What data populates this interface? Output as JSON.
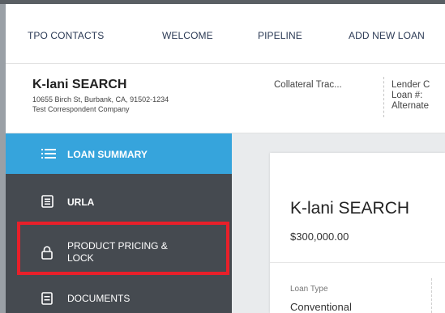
{
  "nav": {
    "items": [
      "TPO CONTACTS",
      "WELCOME",
      "PIPELINE",
      "ADD NEW LOAN"
    ]
  },
  "borrower": {
    "name": "K-lani SEARCH",
    "address": "10655 Birch St, Burbank, CA, 91502-1234",
    "company": "Test Correspondent Company",
    "collateral": "Collateral Trac...",
    "lender_lines": [
      "Lender C",
      "Loan #:",
      "Alternate"
    ]
  },
  "sidebar": {
    "items": [
      {
        "label": "LOAN SUMMARY",
        "icon": "list-icon"
      },
      {
        "label": "URLA",
        "icon": "form-icon"
      },
      {
        "label_lines": [
          "PRODUCT PRICING &",
          "LOCK"
        ],
        "icon": "lock-icon"
      },
      {
        "label": "DOCUMENTS",
        "icon": "document-icon"
      }
    ]
  },
  "card": {
    "title": "K-lani SEARCH",
    "amount": "$300,000.00",
    "loan_type_label": "Loan Type",
    "loan_type_value": "Conventional"
  },
  "colors": {
    "active": "#36a4dc",
    "sidebar": "#454a50",
    "highlight": "#e8202a",
    "nav_text": "#2b3a55"
  }
}
